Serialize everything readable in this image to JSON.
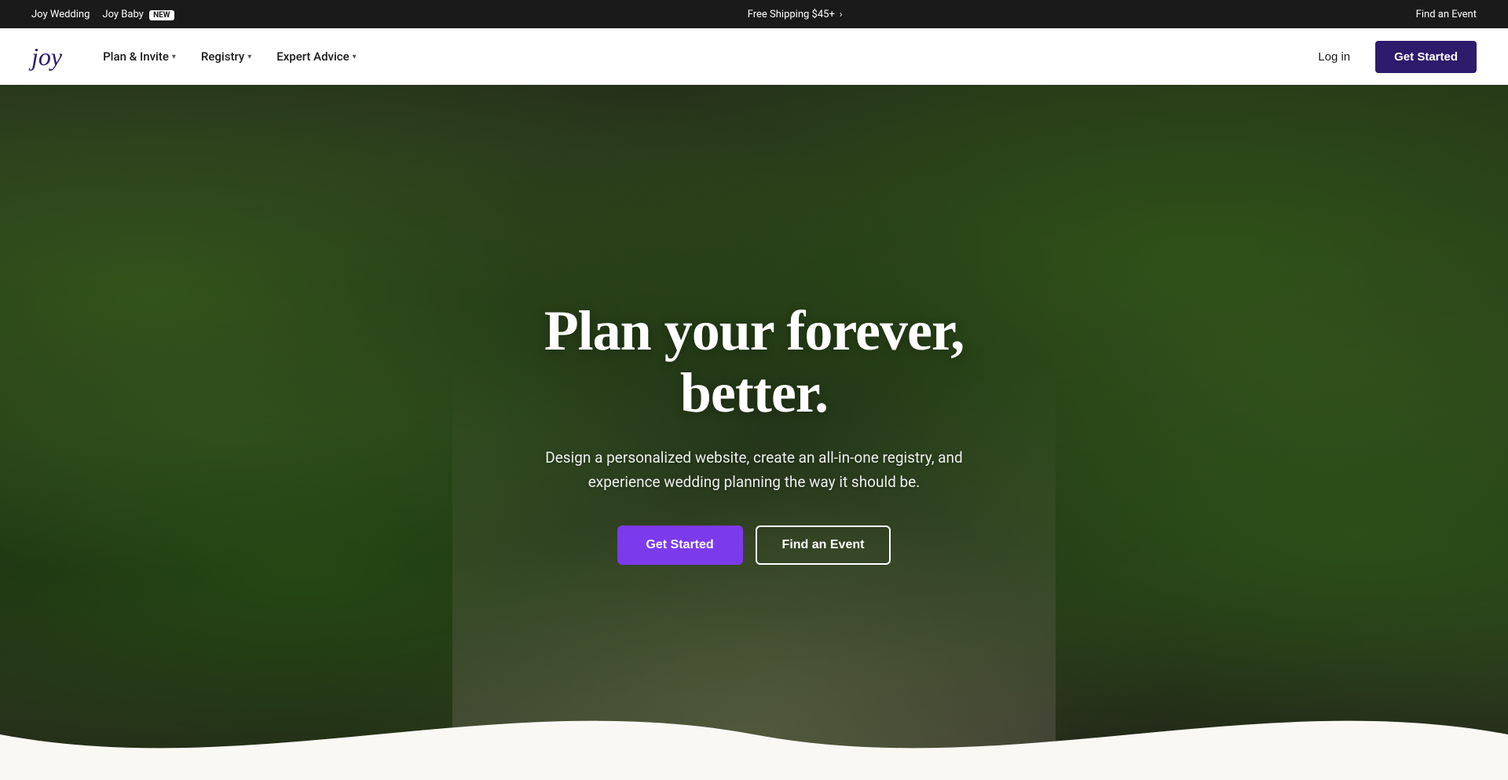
{
  "topBar": {
    "joyWeddingLabel": "Joy Wedding",
    "joyBabyLabel": "Joy Baby",
    "newBadge": "New",
    "shippingText": "Free Shipping $45+",
    "shippingArrow": "›",
    "findAnEventTopLabel": "Find an Event"
  },
  "navbar": {
    "logoText": "joy",
    "planInviteLabel": "Plan & Invite",
    "registryLabel": "Registry",
    "expertAdviceLabel": "Expert Advice",
    "logInLabel": "Log in",
    "getStartedLabel": "Get Started"
  },
  "hero": {
    "title": "Plan your forever, better.",
    "subtitle": "Design a personalized website, create an all-in-one registry, and experience wedding planning the way it should be.",
    "getStartedLabel": "Get Started",
    "findAnEventLabel": "Find an Event"
  }
}
